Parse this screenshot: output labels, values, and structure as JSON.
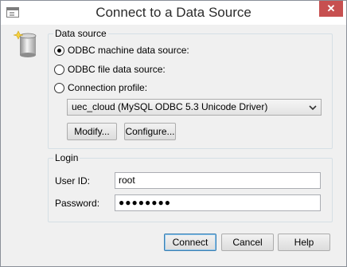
{
  "window": {
    "title": "Connect to a Data Source",
    "close_glyph": "✕"
  },
  "icons": {
    "app": "window-icon",
    "database": "database-icon",
    "close": "close-icon",
    "dropdown": "chevron-down-icon"
  },
  "data_source": {
    "legend": "Data source",
    "options": [
      {
        "label": "ODBC machine data source:",
        "checked": true
      },
      {
        "label": "ODBC file data source:",
        "checked": false
      },
      {
        "label": "Connection profile:",
        "checked": false
      }
    ],
    "selected_source": "uec_cloud (MySQL ODBC 5.3 Unicode Driver)",
    "modify_label": "Modify...",
    "configure_label": "Configure..."
  },
  "login": {
    "legend": "Login",
    "user_id_label": "User ID:",
    "user_id_value": "root",
    "password_label": "Password:",
    "password_mask": "●●●●●●●●"
  },
  "buttons": {
    "connect": "Connect",
    "cancel": "Cancel",
    "help": "Help"
  },
  "colors": {
    "close_button": "#c75050",
    "default_button_border": "#3c7fb1"
  }
}
